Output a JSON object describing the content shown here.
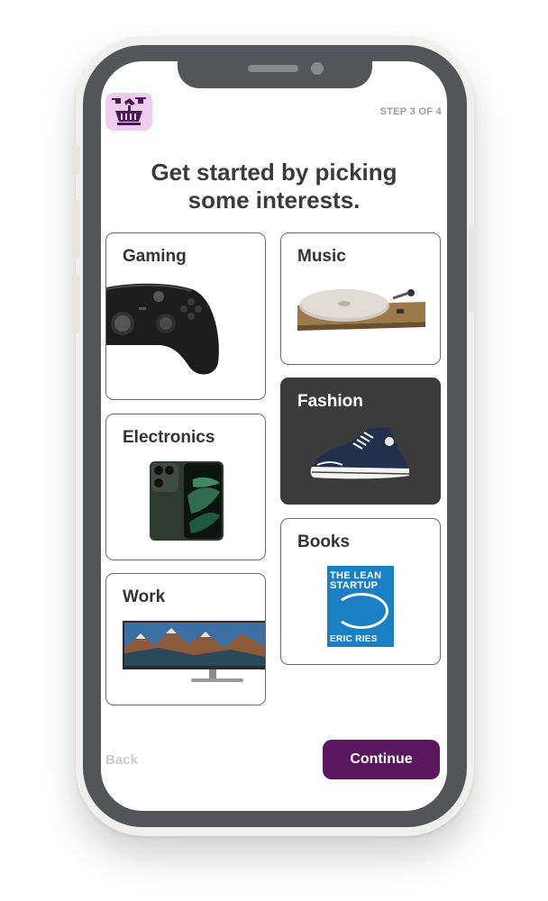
{
  "header": {
    "logo_icon": "market-basket-drone-icon",
    "step_text": "STEP 3 OF 4"
  },
  "title": {
    "line1": "Get started by picking",
    "line2": "some interests."
  },
  "interests": [
    {
      "label": "Gaming",
      "icon": "game-controller",
      "selected": false
    },
    {
      "label": "Music",
      "icon": "turntable",
      "selected": false
    },
    {
      "label": "Fashion",
      "icon": "sneaker",
      "selected": true
    },
    {
      "label": "Electronics",
      "icon": "smartphone",
      "selected": false
    },
    {
      "label": "Books",
      "icon": "book-cover",
      "selected": false,
      "book_title_line1": "THE LEAN",
      "book_title_line2": "STARTUP",
      "book_author": "ERIC RIES"
    },
    {
      "label": "Work",
      "icon": "monitor",
      "selected": false
    }
  ],
  "footer": {
    "back_label": "Back",
    "continue_label": "Continue"
  },
  "colors": {
    "accent": "#5a1760",
    "selected_card": "#3b3b3b",
    "logo_bg": "#efcdf1",
    "bezel": "#525659"
  }
}
